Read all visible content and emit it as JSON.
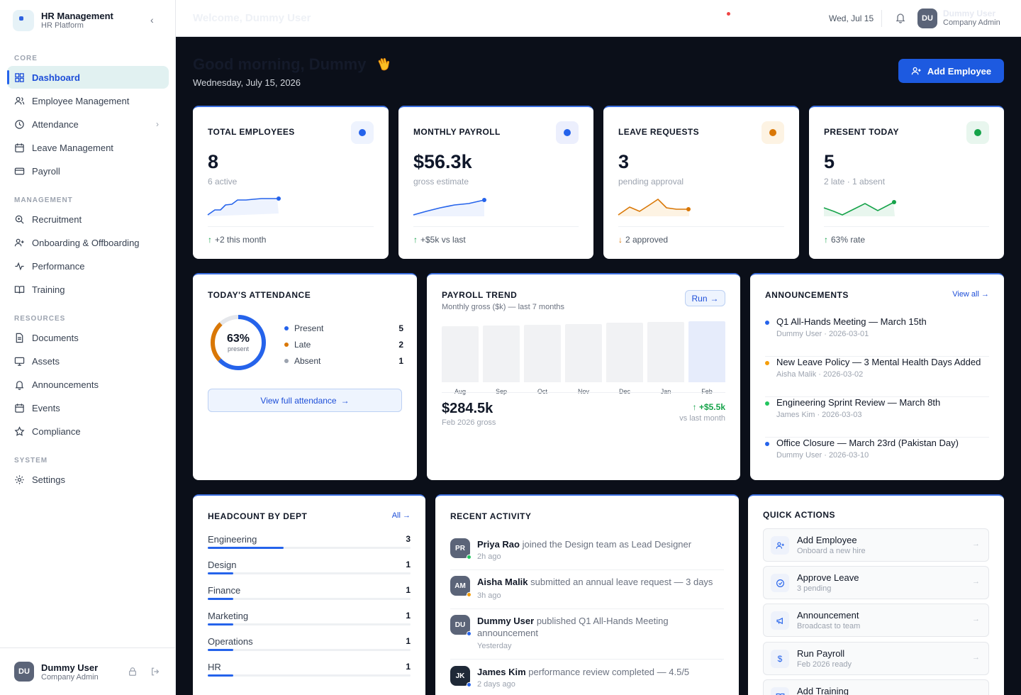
{
  "app": {
    "title": "HR Management",
    "subtitle": "HR Platform"
  },
  "sidebar": {
    "sections": [
      "CORE",
      "MANAGEMENT",
      "RESOURCES",
      "SYSTEM"
    ],
    "items": [
      {
        "label": "Dashboard",
        "icon": "grid-icon"
      },
      {
        "label": "Employee Management",
        "icon": "users-icon"
      },
      {
        "label": "Attendance",
        "icon": "clock-icon"
      },
      {
        "label": "Leave Management",
        "icon": "calendar-icon"
      },
      {
        "label": "Payroll",
        "icon": "card-icon"
      },
      {
        "label": "Recruitment",
        "icon": "search-icon"
      },
      {
        "label": "Onboarding & Offboarding",
        "icon": "user-plus-icon"
      },
      {
        "label": "Performance",
        "icon": "activity-icon"
      },
      {
        "label": "Training",
        "icon": "book-icon"
      },
      {
        "label": "Documents",
        "icon": "document-icon"
      },
      {
        "label": "Assets",
        "icon": "monitor-icon"
      },
      {
        "label": "Announcements",
        "icon": "bell-icon"
      },
      {
        "label": "Events",
        "icon": "calendar-icon"
      },
      {
        "label": "Compliance",
        "icon": "star-icon"
      },
      {
        "label": "Settings",
        "icon": "gear-icon"
      }
    ],
    "user": {
      "initials": "DU",
      "name": "Dummy User",
      "role": "Company Admin"
    }
  },
  "topbar": {
    "welcome": "Welcome, Dummy User",
    "date": "Wed, Jul 15",
    "user": {
      "initials": "DU",
      "name": "Dummy User",
      "role": "Company Admin"
    }
  },
  "header": {
    "greeting": "Good morning, Dummy",
    "date": "Wednesday, July 15, 2026",
    "add_button": "Add Employee"
  },
  "stats": [
    {
      "label": "TOTAL EMPLOYEES",
      "value": "8",
      "sub": "6 active",
      "trend_arrow": "↑",
      "trend": "+2 this month",
      "color": "#2563eb",
      "bg": "#eef3fe"
    },
    {
      "label": "MONTHLY PAYROLL",
      "value": "$56.3k",
      "sub": "gross estimate",
      "trend_arrow": "↑",
      "trend": "+$5k vs last",
      "color": "#2563eb",
      "bg": "#eceffd"
    },
    {
      "label": "LEAVE REQUESTS",
      "value": "3",
      "sub": "pending approval",
      "trend_arrow": "↓",
      "trend": "2 approved",
      "color": "#d97706",
      "bg": "#fdf3e3"
    },
    {
      "label": "PRESENT TODAY",
      "value": "5",
      "sub": "2 late · 1 absent",
      "trend_arrow": "↑",
      "trend": "63% rate",
      "color": "#16a34a",
      "bg": "#e8f6ee"
    }
  ],
  "attendance": {
    "title": "TODAY'S ATTENDANCE",
    "percent": "63%",
    "percent_label": "present",
    "legend": [
      {
        "label": "Present",
        "value": "5",
        "color": "#2563eb"
      },
      {
        "label": "Late",
        "value": "2",
        "color": "#d97706"
      },
      {
        "label": "Absent",
        "value": "1",
        "color": "#9ca3af"
      }
    ],
    "button": "View full attendance"
  },
  "payroll": {
    "title": "PAYROLL TREND",
    "subtitle": "Monthly gross ($k) — last 7 months",
    "run_label": "Run",
    "total": "$284.5k",
    "total_label": "Feb 2026 gross",
    "change": "+$5.5k",
    "change_label": "vs last month"
  },
  "chart_data": {
    "type": "bar",
    "categories": [
      "Aug",
      "Sep",
      "Oct",
      "Nov",
      "Dec",
      "Jan",
      "Feb"
    ],
    "values": [
      64,
      65,
      66,
      67,
      68,
      69,
      70
    ],
    "title": "",
    "xlabel": "",
    "ylabel": ""
  },
  "announcements": {
    "title": "ANNOUNCEMENTS",
    "view_all": "View all →",
    "items": [
      {
        "title": "Q1 All-Hands Meeting — March 15th",
        "meta": "Dummy User · 2026-03-01",
        "color": "#2563eb"
      },
      {
        "title": "New Leave Policy — 3 Mental Health Days Added",
        "meta": "Aisha Malik · 2026-03-02",
        "color": "#f59e0b"
      },
      {
        "title": "Engineering Sprint Review — March 8th",
        "meta": "James Kim · 2026-03-03",
        "color": "#22c55e"
      },
      {
        "title": "Office Closure — March 23rd (Pakistan Day)",
        "meta": "Dummy User · 2026-03-10",
        "color": "#2563eb"
      }
    ]
  },
  "headcount": {
    "title": "HEADCOUNT BY DEPT",
    "all_label": "All →",
    "depts": [
      {
        "name": "Engineering",
        "count": "3",
        "share": 0.375
      },
      {
        "name": "Design",
        "count": "1",
        "share": 0.125
      },
      {
        "name": "Finance",
        "count": "1",
        "share": 0.125
      },
      {
        "name": "Marketing",
        "count": "1",
        "share": 0.125
      },
      {
        "name": "Operations",
        "count": "1",
        "share": 0.125
      },
      {
        "name": "HR",
        "count": "1",
        "share": 0.125
      }
    ]
  },
  "activity": {
    "title": "RECENT ACTIVITY",
    "items": [
      {
        "initials": "PR",
        "name": "Priya Rao",
        "text": "joined the Design team as Lead Designer",
        "time": "2h ago",
        "status": "#22c55e"
      },
      {
        "initials": "AM",
        "name": "Aisha Malik",
        "text": "submitted an annual leave request — 3 days",
        "time": "3h ago",
        "status": "#f59e0b"
      },
      {
        "initials": "DU",
        "name": "Dummy User",
        "text": "published Q1 All-Hands Meeting announcement",
        "time": "Yesterday",
        "status": "#2563eb"
      },
      {
        "initials": "JK",
        "name": "James Kim",
        "text": "performance review completed — 4.5/5",
        "time": "2 days ago",
        "status": "#2563eb"
      }
    ]
  },
  "quick_actions": {
    "title": "QUICK ACTIONS",
    "items": [
      {
        "title": "Add Employee",
        "sub": "Onboard a new hire",
        "icon": "user-plus-icon"
      },
      {
        "title": "Approve Leave",
        "sub": "3 pending",
        "icon": "check-circle-icon"
      },
      {
        "title": "Announcement",
        "sub": "Broadcast to team",
        "icon": "megaphone-icon"
      },
      {
        "title": "Run Payroll",
        "sub": "Feb 2026 ready",
        "icon": "dollar-icon"
      },
      {
        "title": "Add Training",
        "sub": "",
        "icon": "book-icon"
      }
    ]
  }
}
